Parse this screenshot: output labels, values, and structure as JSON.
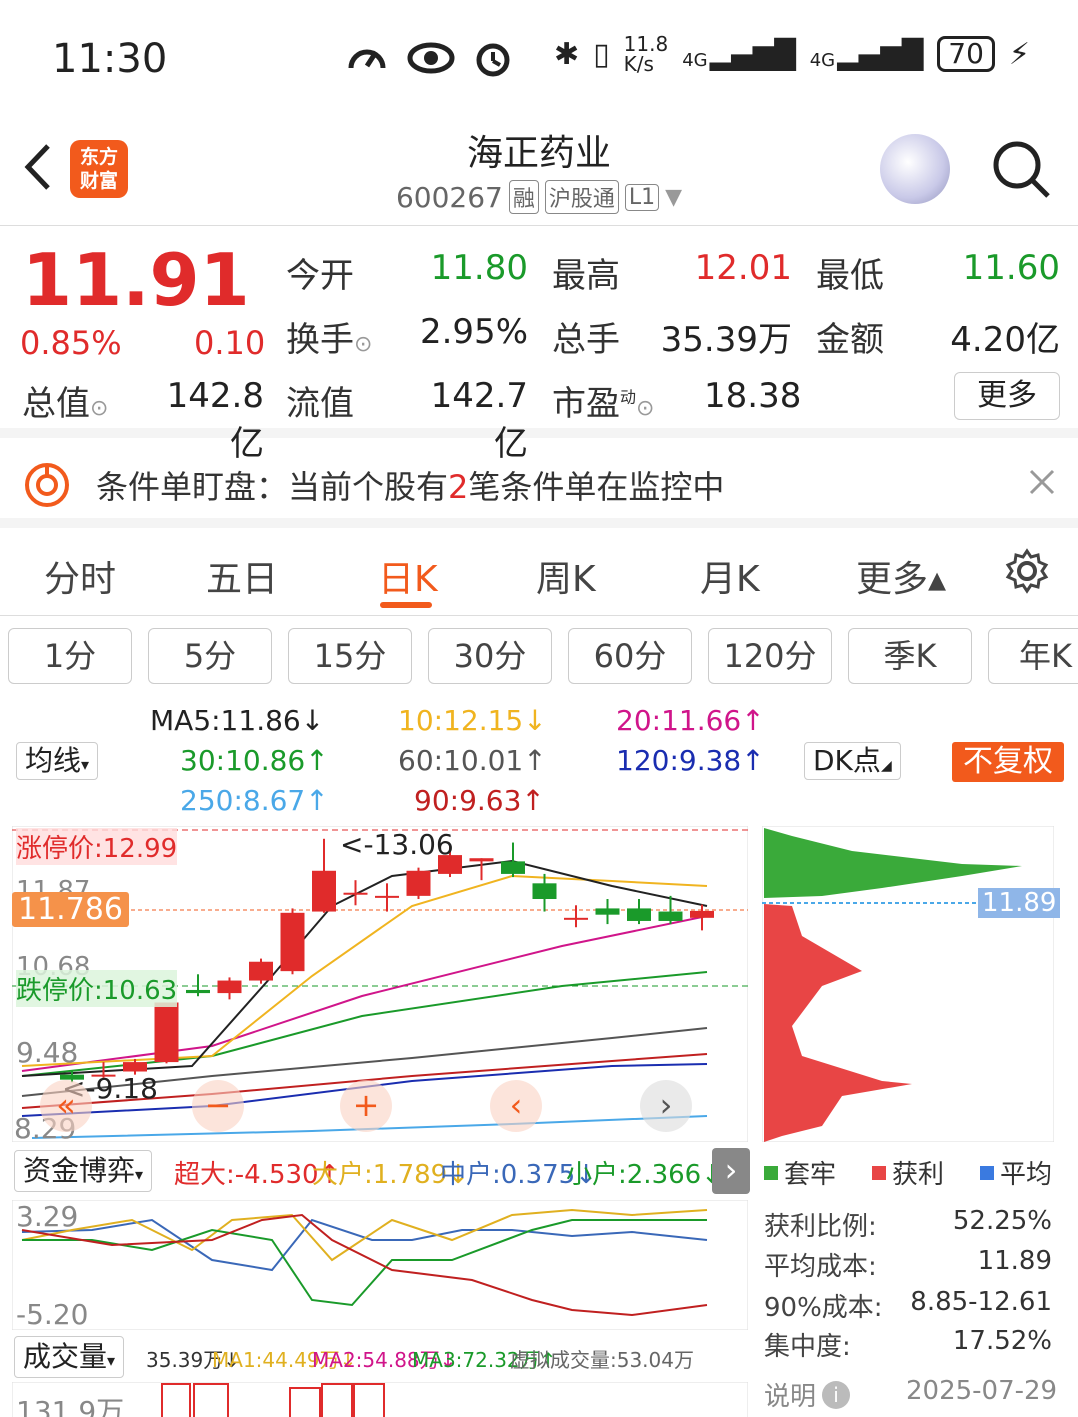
{
  "status": {
    "time": "11:30",
    "net_speed_top": "11.8",
    "net_speed_bottom": "K/s",
    "sig1": "4G",
    "sig2": "4G",
    "battery": "70"
  },
  "header": {
    "logo_line1": "东方",
    "logo_line2": "财富",
    "title": "海正药业",
    "code": "600267",
    "tags": [
      "融",
      "沪股通",
      "L1"
    ]
  },
  "quote": {
    "price": "11.91",
    "change_pct": "0.85%",
    "change_abs": "0.10",
    "open_label": "今开",
    "open": "11.80",
    "high_label": "最高",
    "high": "12.01",
    "low_label": "最低",
    "low": "11.60",
    "turnover_label": "换手",
    "turnover": "2.95%",
    "volume_label": "总手",
    "volume": "35.39万",
    "amount_label": "金额",
    "amount": "4.20亿",
    "mcap_label": "总值",
    "mcap": "142.8亿",
    "float_label": "流值",
    "float": "142.7亿",
    "pe_label": "市盈",
    "pe_sup": "动",
    "pe": "18.38",
    "more": "更多"
  },
  "notice": {
    "prefix": "条件单盯盘：当前个股有",
    "count": "2",
    "suffix": "笔条件单在监控中"
  },
  "tabs": [
    "分时",
    "五日",
    "日K",
    "周K",
    "月K",
    "更多▴"
  ],
  "periods": [
    "1分",
    "5分",
    "15分",
    "30分",
    "60分",
    "120分",
    "季K",
    "年K"
  ],
  "ma": {
    "selector": "均线",
    "ma5": "MA5:11.86↓",
    "ma10": "10:12.15↓",
    "ma20": "20:11.66↑",
    "ma30": "30:10.86↑",
    "ma60": "60:10.01↑",
    "ma120": "120:9.38↑",
    "ma250": "250:8.67↑",
    "ma90": "90:9.63↑",
    "dk": "DK点",
    "adjust": "不复权"
  },
  "kchart": {
    "limit_up": "涨停价:12.99",
    "limit_down": "跌停价:10.63",
    "y_top": "12.99",
    "y_1187": "11.87",
    "current_tag": "11.786",
    "y_1068": "10.68",
    "y_948": "9.48",
    "y_829": "8.29",
    "high_mark": "<-13.06",
    "low_mark": "<-9.18",
    "chip_price": "11.89"
  },
  "chart_data": {
    "type": "candlestick",
    "title": "",
    "ylim": [
      8.29,
      13.2
    ],
    "candles": [
      {
        "o": 9.3,
        "c": 9.22,
        "h": 9.35,
        "l": 9.18
      },
      {
        "o": 9.3,
        "c": 9.3,
        "h": 9.5,
        "l": 9.25
      },
      {
        "o": 9.35,
        "c": 9.5,
        "h": 9.55,
        "l": 9.3
      },
      {
        "o": 9.5,
        "c": 10.45,
        "h": 10.45,
        "l": 9.48
      },
      {
        "o": 10.65,
        "c": 10.6,
        "h": 10.9,
        "l": 10.55
      },
      {
        "o": 10.6,
        "c": 10.8,
        "h": 10.85,
        "l": 10.5
      },
      {
        "o": 10.8,
        "c": 11.1,
        "h": 11.15,
        "l": 10.75
      },
      {
        "o": 10.95,
        "c": 11.88,
        "h": 11.95,
        "l": 10.9
      },
      {
        "o": 11.9,
        "c": 12.55,
        "h": 13.06,
        "l": 11.88
      },
      {
        "o": 12.2,
        "c": 12.2,
        "h": 12.4,
        "l": 12.0
      },
      {
        "o": 12.15,
        "c": 12.15,
        "h": 12.35,
        "l": 11.9
      },
      {
        "o": 12.15,
        "c": 12.55,
        "h": 12.6,
        "l": 12.1
      },
      {
        "o": 12.5,
        "c": 12.8,
        "h": 12.95,
        "l": 12.45
      },
      {
        "o": 12.7,
        "c": 12.75,
        "h": 12.75,
        "l": 12.4
      },
      {
        "o": 12.7,
        "c": 12.5,
        "h": 13.0,
        "l": 12.45
      },
      {
        "o": 12.35,
        "c": 12.1,
        "h": 12.5,
        "l": 11.9
      },
      {
        "o": 11.8,
        "c": 11.8,
        "h": 12.0,
        "l": 11.65
      },
      {
        "o": 11.95,
        "c": 11.85,
        "h": 12.1,
        "l": 11.7
      },
      {
        "o": 11.95,
        "c": 11.75,
        "h": 12.1,
        "l": 11.7
      },
      {
        "o": 11.9,
        "c": 11.75,
        "h": 12.15,
        "l": 11.7
      },
      {
        "o": 11.8,
        "c": 11.91,
        "h": 12.01,
        "l": 11.6
      }
    ]
  },
  "chip": {
    "legend": [
      "套牢",
      "获利",
      "平均"
    ],
    "stats": [
      {
        "label": "获利比例:",
        "value": "52.25%"
      },
      {
        "label": "平均成本:",
        "value": "11.89"
      },
      {
        "label": "90%成本:",
        "value": "8.85-12.61"
      },
      {
        "label": "集中度:",
        "value": "17.52%"
      }
    ],
    "explain": "说明",
    "date": "2025-07-29"
  },
  "fund": {
    "selector": "资金博弈",
    "super": "超大:-4.530↑",
    "big": "大户:1.789↓",
    "mid": "中户:0.375↓",
    "small": "小户:2.366↓",
    "y_top": "3.29",
    "y_bottom": "-5.20"
  },
  "vol": {
    "selector": "成交量",
    "v": "35.39万↓",
    "ma1": "MA1:44.49万↓",
    "ma2": "MA2:54.88万↓",
    "ma3": "MA3:72.32万↑",
    "virtual": "虚拟成交量:53.04万",
    "y_top": "131.9万"
  },
  "colors": {
    "up": "#e02b2b",
    "down": "#1a9a2a",
    "accent": "#f25a1c"
  }
}
